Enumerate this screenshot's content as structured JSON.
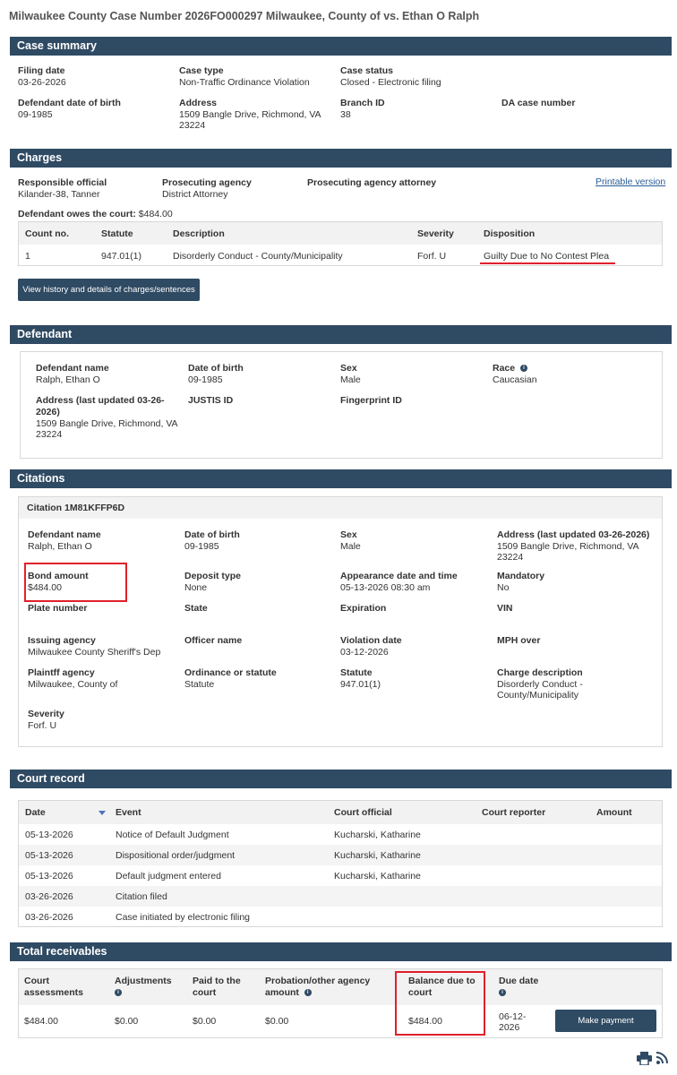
{
  "title": "Milwaukee County Case Number 2026FO000297 Milwaukee, County of vs. Ethan O Ralph",
  "case_summary": {
    "heading": "Case summary",
    "filing_date_label": "Filing date",
    "filing_date": "03-26-2026",
    "case_type_label": "Case type",
    "case_type": "Non-Traffic Ordinance Violation",
    "case_status_label": "Case status",
    "case_status": "Closed - Electronic filing",
    "dob_label": "Defendant date of birth",
    "dob": "09-1985",
    "address_label": "Address",
    "address_1": "1509 Bangle Drive, Richmond, VA",
    "address_2": "23224",
    "branch_label": "Branch ID",
    "branch": "38",
    "da_label": "DA case number"
  },
  "charges": {
    "heading": "Charges",
    "official_label": "Responsible official",
    "official": "Kilander-38, Tanner",
    "agency_label": "Prosecuting agency",
    "agency": "District Attorney",
    "attorney_label": "Prosecuting agency attorney",
    "printable": "Printable version",
    "owes_label": "Defendant owes the court:",
    "owes": "$484.00",
    "columns": [
      "Count no.",
      "Statute",
      "Description",
      "Severity",
      "Disposition"
    ],
    "row": [
      "1",
      "947.01(1)",
      "Disorderly Conduct - County/Municipality",
      "Forf. U",
      "Guilty Due to No Contest Plea"
    ],
    "history_button": "View history and details of charges/sentences"
  },
  "defendant": {
    "heading": "Defendant",
    "name_label": "Defendant name",
    "name": "Ralph, Ethan O",
    "dob_label": "Date of birth",
    "dob": "09-1985",
    "sex_label": "Sex",
    "sex": "Male",
    "race_label": "Race",
    "race": "Caucasian",
    "address_label_1": "Address (last updated 03-26-",
    "address_label_2": "2026)",
    "address_1": "1509 Bangle Drive, Richmond, VA",
    "address_2": "23224",
    "justis_label": "JUSTIS ID",
    "fingerprint_label": "Fingerprint ID"
  },
  "citations": {
    "heading": "Citations",
    "citation_title": "Citation 1M81KFFP6D",
    "name_label": "Defendant name",
    "name": "Ralph, Ethan O",
    "dob_label": "Date of birth",
    "dob": "09-1985",
    "sex_label": "Sex",
    "sex": "Male",
    "address_label": "Address (last updated 03-26-2026)",
    "address_1": "1509 Bangle Drive, Richmond, VA",
    "address_2": "23224",
    "bond_label": "Bond amount",
    "bond": "$484.00",
    "deposit_label": "Deposit type",
    "deposit": "None",
    "appearance_label": "Appearance date and time",
    "appearance": "05-13-2026 08:30 am",
    "mandatory_label": "Mandatory",
    "mandatory": "No",
    "plate_label": "Plate number",
    "state_label": "State",
    "expiration_label": "Expiration",
    "vin_label": "VIN",
    "issuing_label": "Issuing agency",
    "issuing": "Milwaukee County Sheriff's Dep",
    "officer_label": "Officer name",
    "violation_label": "Violation date",
    "violation": "03-12-2026",
    "mph_label": "MPH over",
    "plaintiff_label": "Plaintff agency",
    "plaintiff": "Milwaukee, County of",
    "ordinance_label": "Ordinance or statute",
    "ordinance": "Statute",
    "statute_label": "Statute",
    "statute": "947.01(1)",
    "charge_label": "Charge description",
    "charge_1": "Disorderly Conduct -",
    "charge_2": "County/Municipality",
    "severity_label": "Severity",
    "severity": "Forf. U"
  },
  "court_record": {
    "heading": "Court record",
    "columns": [
      "Date",
      "Event",
      "Court official",
      "Court reporter",
      "Amount"
    ],
    "rows": [
      {
        "date": "05-13-2026",
        "event": "Notice of Default Judgment",
        "official": "Kucharski, Katharine"
      },
      {
        "date": "05-13-2026",
        "event": "Dispositional order/judgment",
        "official": "Kucharski, Katharine"
      },
      {
        "date": "05-13-2026",
        "event": "Default judgment entered",
        "official": "Kucharski, Katharine"
      },
      {
        "date": "03-26-2026",
        "event": "Citation filed",
        "official": ""
      },
      {
        "date": "03-26-2026",
        "event": "Case initiated by electronic filing",
        "official": ""
      }
    ]
  },
  "receivables": {
    "heading": "Total receivables",
    "court_assessments_1": "Court",
    "court_assessments_2": "assessments",
    "adjustments": "Adjustments",
    "paid_1": "Paid to the",
    "paid_2": "court",
    "probation_1": "Probation/other agency",
    "probation_2": "amount",
    "balance_1": "Balance due to",
    "balance_2": "court",
    "due_date": "Due date",
    "values": {
      "court": "$484.00",
      "adjustments": "$0.00",
      "paid": "$0.00",
      "probation": "$0.00",
      "balance": "$484.00",
      "due_1": "06-12-",
      "due_2": "2026"
    },
    "pay_button": "Make payment"
  },
  "icons": [
    "info-icon",
    "sort-down-icon",
    "print-icon",
    "rss-icon"
  ],
  "colors": {
    "header_bar": "#2f4a63",
    "highlight": "#e0202a",
    "link": "#2a5d96"
  }
}
